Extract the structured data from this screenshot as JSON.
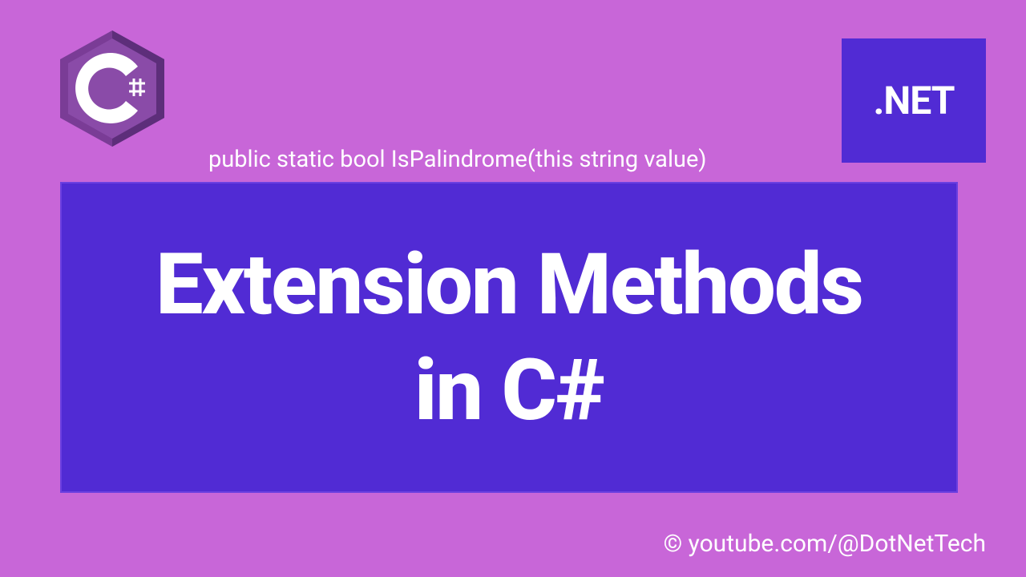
{
  "dotnet": {
    "label": ".NET"
  },
  "code_snippet": "public static bool IsPalindrome(this string value)",
  "title": {
    "line1": "Extension Methods",
    "line2": "in C#"
  },
  "attribution": "© youtube.com/@DotNetTech"
}
